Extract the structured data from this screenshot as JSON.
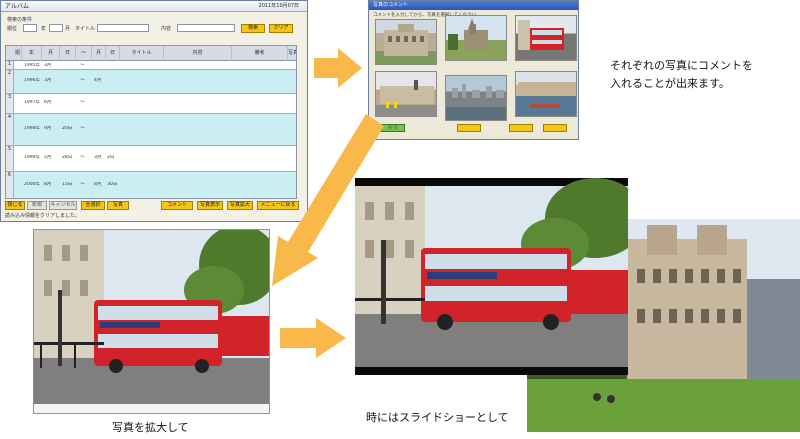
{
  "main_window": {
    "title": "アルバム",
    "date": "2011年10月07日",
    "search_caption": "検索の条件",
    "search_fields": [
      "順位",
      "年",
      "月",
      "タイトル",
      "内容"
    ],
    "search_button": "検索",
    "clear_button": "クリア",
    "columns": [
      "順位",
      "年",
      "月",
      "日",
      "〜",
      "月",
      "日",
      "タイトル",
      "内容",
      "備考",
      "写真"
    ],
    "rows": [
      {
        "num": "1",
        "year": "1995年",
        "month": "3月",
        "tilde": "〜",
        "title": "",
        "content": "",
        "note": ""
      },
      {
        "num": "2",
        "year": "1996年",
        "month": "3月",
        "day": "",
        "tilde": "〜",
        "month2": "4月",
        "day2": "",
        "title": "",
        "content": "",
        "note": ""
      },
      {
        "num": "3",
        "year": "1997年",
        "month": "6月",
        "tilde": "〜",
        "title": "",
        "content": "",
        "note": ""
      },
      {
        "num": "4",
        "year": "1998年",
        "month": "9月",
        "day": "20日",
        "tilde": "〜",
        "title": "",
        "content": "",
        "note": ""
      },
      {
        "num": "5",
        "year": "1999年",
        "month": "2月",
        "day": "28日",
        "tilde": "〜",
        "month2": "3月",
        "day2": "2日",
        "title": "",
        "content": "",
        "note": ""
      },
      {
        "num": "6",
        "year": "2000年",
        "month": "8月",
        "day": "15日",
        "tilde": "〜",
        "month2": "8月",
        "day2": "30日",
        "title": "",
        "content": "",
        "note": ""
      }
    ],
    "bottom_buttons": [
      "閉じる",
      "新規",
      "キャンセル",
      "全選択",
      "写真",
      "コメント",
      "写真表示",
      "写真拡大",
      "メニューに戻る"
    ],
    "status": "読み込み情報をクリアしました。"
  },
  "comment_window": {
    "title": "写真のコメント",
    "hint": "コメントを入力してから、写真を選択してください",
    "thumb_labels": [
      "",
      "",
      "",
      "",
      "",
      ""
    ],
    "status": "",
    "buttons": [
      "戻る",
      "",
      "",
      ""
    ]
  },
  "captions": {
    "comment": "それぞれの写真にコメントを\n入れることが出来ます。",
    "zoom": "写真を拡大して",
    "slideshow": "時にはスライドショーとして"
  },
  "colors": {
    "arrow": "#f9b94a",
    "row_cyan": "#c9eff3",
    "bus_red": "#d2232a",
    "sky": "#dfe9f3",
    "tree": "#4f7a2c"
  }
}
